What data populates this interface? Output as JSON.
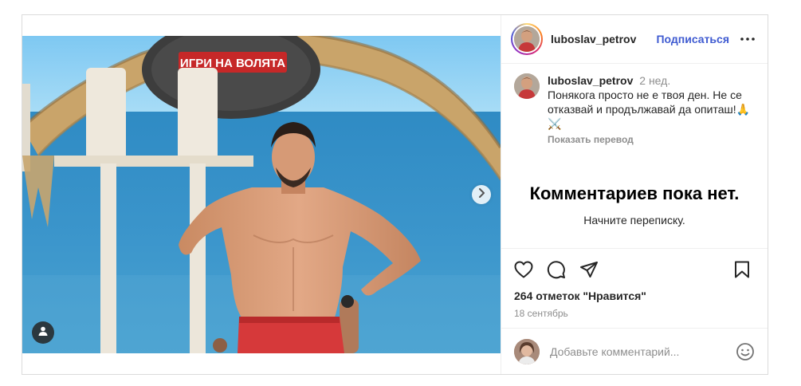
{
  "header": {
    "username": "luboslav_petrov",
    "follow_label": "Подписаться"
  },
  "caption": {
    "username": "luboslav_petrov",
    "time": "2 нед.",
    "text": "Понякога просто не е твоя ден. Не се отказвай и продължавай да опиташ!🙏⚔️",
    "translate_label": "Показать перевод"
  },
  "comments": {
    "empty_title": "Комментариев пока нет.",
    "empty_subtitle": "Начните переписку."
  },
  "footer": {
    "likes": "264 отметок \"Нравится\"",
    "date": "18 сентябрь"
  },
  "comment_box": {
    "placeholder": "Добавьте комментарий..."
  },
  "media": {
    "sign_text": "ИГРИ НА ВОЛЯТА"
  },
  "icons": {
    "heart": "heart-icon",
    "comment": "comment-icon",
    "share": "share-icon",
    "save": "bookmark-icon",
    "more": "more-dots-icon",
    "next": "chevron-right-icon",
    "tag": "user-tag-icon",
    "emoji": "emoji-icon"
  },
  "colors": {
    "accent": "#3f5bd1",
    "muted": "#8e8e8e",
    "text": "#262626",
    "border": "#dbdbdb"
  }
}
